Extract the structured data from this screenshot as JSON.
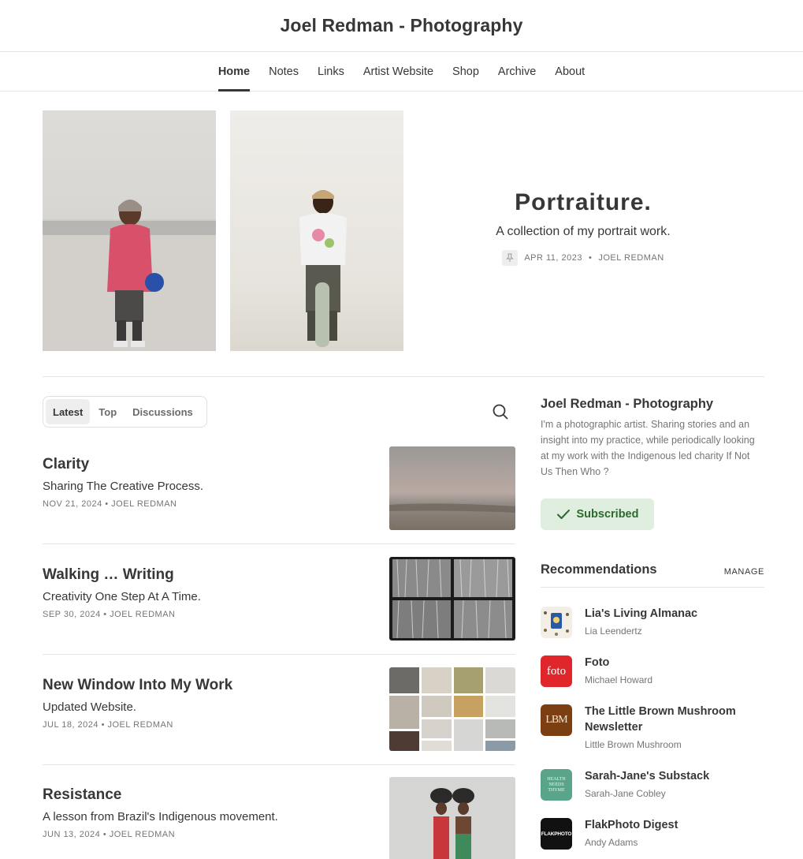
{
  "site": {
    "title": "Joel Redman - Photography"
  },
  "nav": [
    {
      "label": "Home"
    },
    {
      "label": "Notes"
    },
    {
      "label": "Links"
    },
    {
      "label": "Artist Website"
    },
    {
      "label": "Shop"
    },
    {
      "label": "Archive"
    },
    {
      "label": "About"
    }
  ],
  "hero": {
    "title": "Portraiture.",
    "subtitle": "A collection of my portrait work.",
    "date": "APR 11, 2023",
    "author": "JOEL REDMAN"
  },
  "feed_tabs": [
    {
      "label": "Latest",
      "active": true
    },
    {
      "label": "Top",
      "active": false
    },
    {
      "label": "Discussions",
      "active": false
    }
  ],
  "posts": [
    {
      "title": "Clarity",
      "subtitle": "Sharing The Creative Process.",
      "meta": "NOV 21, 2024 • JOEL REDMAN"
    },
    {
      "title": "Walking … Writing",
      "subtitle": "Creativity One Step At A Time.",
      "meta": "SEP 30, 2024 • JOEL REDMAN"
    },
    {
      "title": "New Window Into My Work",
      "subtitle": "Updated Website.",
      "meta": "JUL 18, 2024 • JOEL REDMAN"
    },
    {
      "title": "Resistance",
      "subtitle": "A lesson from Brazil's Indigenous movement.",
      "meta": "JUN 13, 2024 • JOEL REDMAN"
    }
  ],
  "sidebar": {
    "title": "Joel Redman - Photography",
    "description": "I'm a photographic artist. Sharing stories and an insight into my practice, while periodically looking at my work with the Indigenous led charity If Not Us Then Who ?",
    "subscribed_label": "Subscribed",
    "recommendations_label": "Recommendations",
    "manage_label": "MANAGE"
  },
  "recommendations": [
    {
      "name": "Lia's Living Almanac",
      "author": "Lia Leendertz",
      "logo_text": ""
    },
    {
      "name": "Foto",
      "author": "Michael Howard",
      "logo_text": "foto"
    },
    {
      "name": "The Little Brown Mushroom Newsletter",
      "author": "Little Brown Mushroom",
      "logo_text": "LBM"
    },
    {
      "name": "Sarah-Jane's Substack",
      "author": "Sarah-Jane Cobley",
      "logo_text": "HEALTH NEEDS THYME"
    },
    {
      "name": "FlakPhoto Digest",
      "author": "Andy Adams",
      "logo_text": "FLAKPHOTO"
    }
  ],
  "colors": {
    "text": "#363737",
    "muted": "#757575",
    "subscribed_bg": "#dfeedf",
    "subscribed_text": "#2d6a2d",
    "foto_red": "#e0262b",
    "lbm_brown": "#7b3f12",
    "thyme_green": "#5aa58a"
  }
}
